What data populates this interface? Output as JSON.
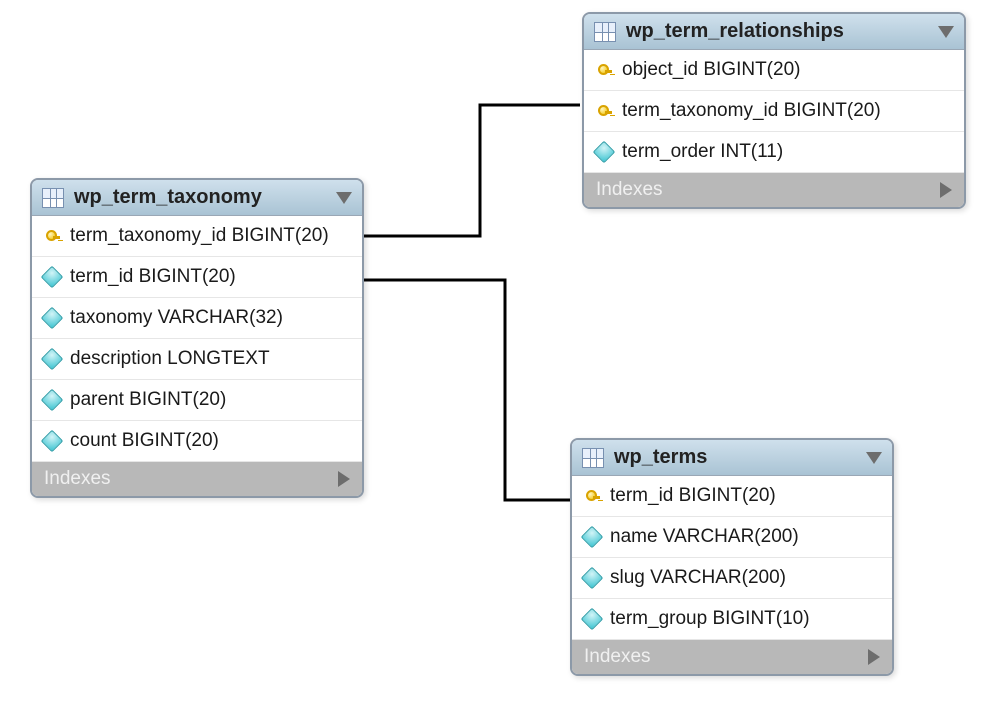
{
  "tables": {
    "taxonomy": {
      "name": "wp_term_taxonomy",
      "columns": [
        {
          "icon": "key",
          "label": "term_taxonomy_id BIGINT(20)"
        },
        {
          "icon": "diamond",
          "label": "term_id BIGINT(20)"
        },
        {
          "icon": "diamond",
          "label": "taxonomy VARCHAR(32)"
        },
        {
          "icon": "diamond",
          "label": "description LONGTEXT"
        },
        {
          "icon": "diamond",
          "label": "parent BIGINT(20)"
        },
        {
          "icon": "diamond",
          "label": "count BIGINT(20)"
        }
      ],
      "indexes_label": "Indexes"
    },
    "relationships": {
      "name": "wp_term_relationships",
      "columns": [
        {
          "icon": "key",
          "label": "object_id BIGINT(20)"
        },
        {
          "icon": "key",
          "label": "term_taxonomy_id BIGINT(20)"
        },
        {
          "icon": "diamond",
          "label": "term_order INT(11)"
        }
      ],
      "indexes_label": "Indexes"
    },
    "terms": {
      "name": "wp_terms",
      "columns": [
        {
          "icon": "key",
          "label": "term_id BIGINT(20)"
        },
        {
          "icon": "diamond",
          "label": "name VARCHAR(200)"
        },
        {
          "icon": "diamond",
          "label": "slug VARCHAR(200)"
        },
        {
          "icon": "diamond",
          "label": "term_group BIGINT(10)"
        }
      ],
      "indexes_label": "Indexes"
    }
  }
}
